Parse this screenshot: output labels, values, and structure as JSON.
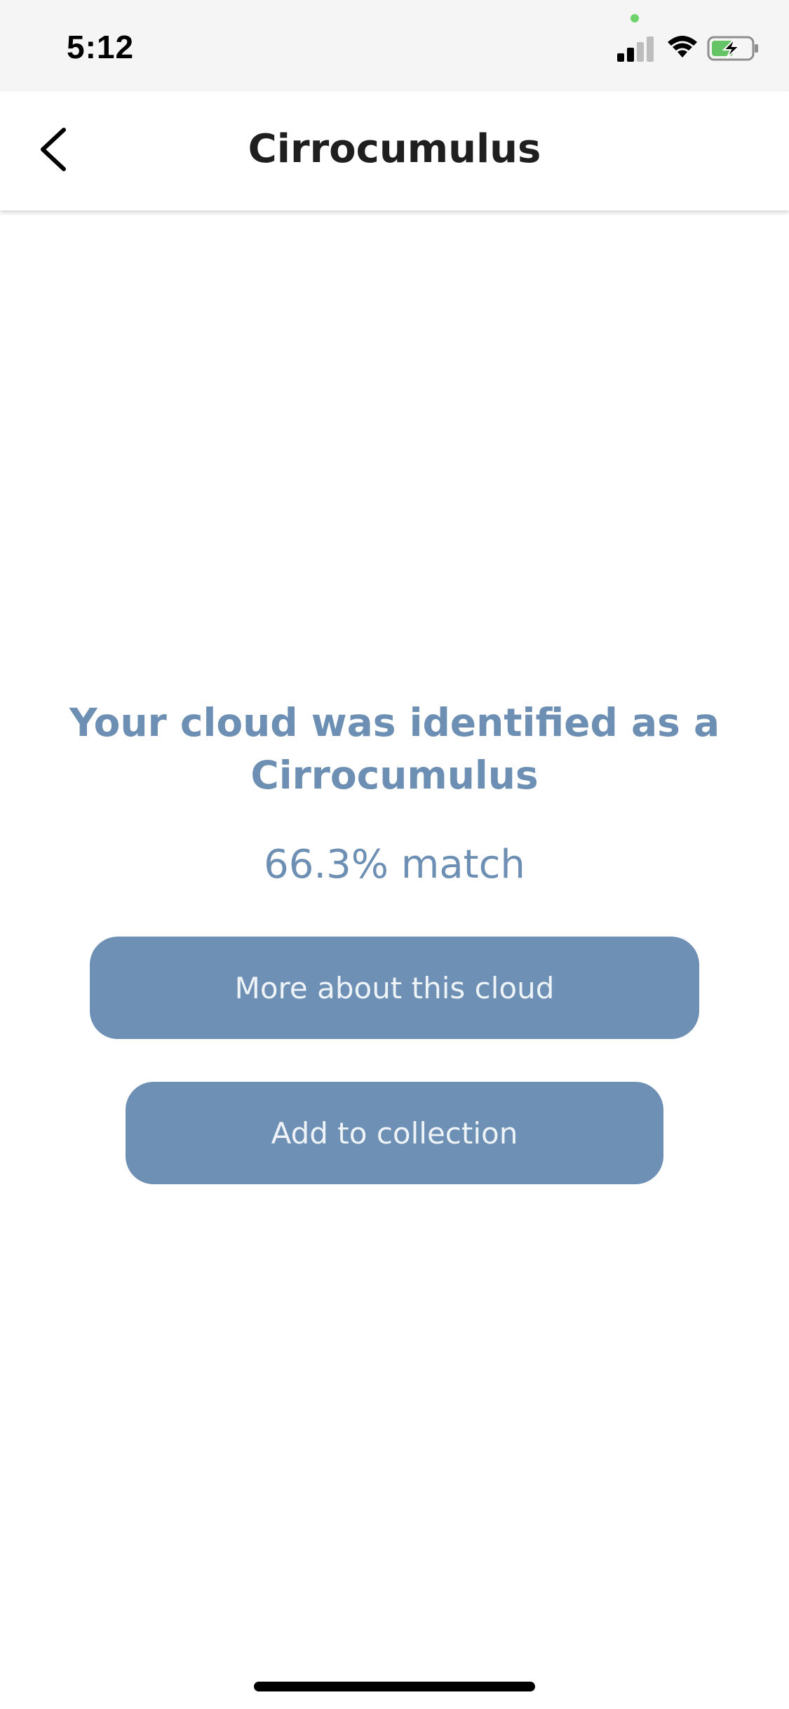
{
  "status_bar": {
    "time": "5:12",
    "icons": [
      "privacy-dot",
      "cellular-signal-icon",
      "wifi-icon",
      "battery-charging-icon"
    ]
  },
  "nav": {
    "title": "Cirrocumulus",
    "back_icon": "chevron-left-icon"
  },
  "result": {
    "heading": "Your cloud was identified as a Cirrocumulus",
    "match": "66.3% match"
  },
  "actions": {
    "more_label": "More about this cloud",
    "add_label": "Add to collection"
  },
  "colors": {
    "accent": "#6e90b4",
    "heading_text": "#6c8fb3",
    "button_text": "#eef3f8",
    "battery_fill": "#65c466"
  }
}
